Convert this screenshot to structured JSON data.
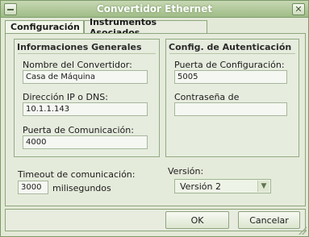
{
  "window": {
    "title": "Convertidor Ethernet",
    "colors": {
      "titlebar": "#9fbc86",
      "background": "#e3e9d7",
      "border": "#7c9a69"
    }
  },
  "tabs": [
    {
      "label": "Configuración",
      "active": true
    },
    {
      "label": "Instrumentos Asociados",
      "active": false
    }
  ],
  "general": {
    "title": "Informaciones Generales",
    "name_label": "Nombre del Convertidor:",
    "name_value": "Casa de Máquina",
    "ip_label": "Dirección IP o DNS:",
    "ip_value": "10.1.1.143",
    "port_label": "Puerta de Comunicación:",
    "port_value": "4000"
  },
  "auth": {
    "title": "Config. de Autenticación",
    "config_port_label": "Puerta de Configuración:",
    "config_port_value": "5005",
    "password_label": "Contraseña de Configuración:",
    "password_value": ""
  },
  "timeout": {
    "label": "Timeout de comunicación:",
    "value": "3000",
    "unit": "milisegundos"
  },
  "version": {
    "label": "Versión:",
    "selected": "Versión 2"
  },
  "buttons": {
    "ok": "OK",
    "cancel": "Cancelar"
  },
  "icons": {
    "minimize": "minimize-icon",
    "close": "close-icon",
    "dropdown": "chevron-down-icon"
  }
}
